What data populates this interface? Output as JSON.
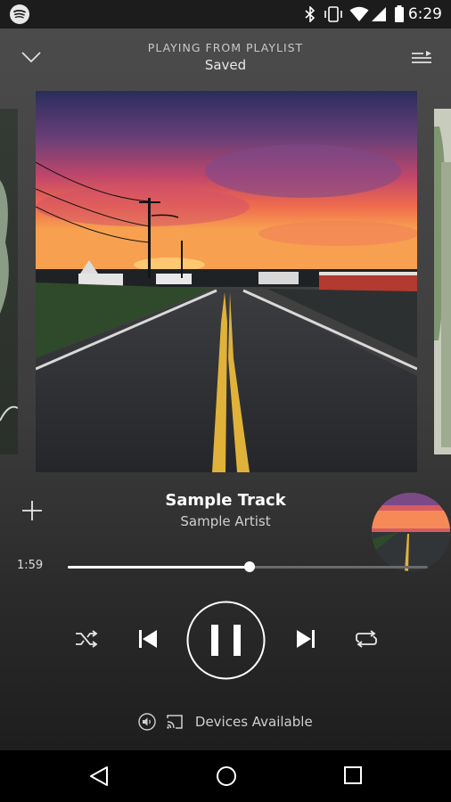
{
  "status_bar": {
    "time": "6:29",
    "icons": [
      "spotify-icon",
      "bluetooth-icon",
      "vibrate-icon",
      "wifi-icon",
      "cell-signal-icon",
      "battery-icon"
    ]
  },
  "header": {
    "context_label": "PLAYING FROM PLAYLIST",
    "playlist_name": "Saved",
    "collapse_icon": "chevron-down-icon",
    "queue_icon": "queue-icon"
  },
  "album_art": {
    "description": "sunset road artwork"
  },
  "track": {
    "title": "Sample Track",
    "artist": "Sample Artist"
  },
  "playback": {
    "elapsed": "1:59",
    "duration": "",
    "progress": 0.505,
    "state": "playing"
  },
  "controls": {
    "add_icon": "plus-icon",
    "shuffle_icon": "shuffle-icon",
    "previous_icon": "previous-icon",
    "pause_icon": "pause-icon",
    "next_icon": "next-icon",
    "repeat_icon": "repeat-icon"
  },
  "devices": {
    "label": "Devices Available"
  },
  "nav_bar": {
    "buttons": [
      "back-icon",
      "home-icon",
      "recents-icon"
    ]
  },
  "colors": {
    "background_top": "#4b4b4b",
    "background_bottom": "#1e1e1e",
    "accent": "#ffffff"
  }
}
